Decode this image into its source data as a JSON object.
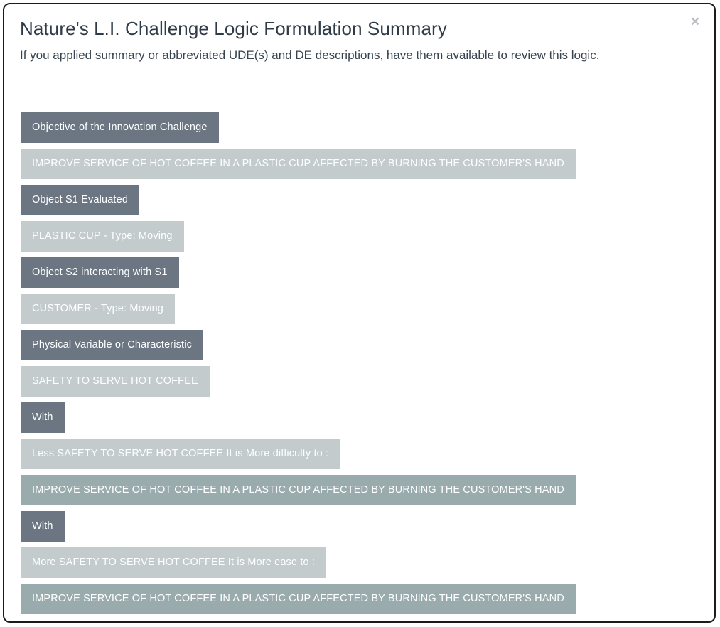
{
  "modal": {
    "title": "Nature's L.I. Challenge Logic Formulation Summary",
    "subtitle": "If you applied summary or abbreviated UDE(s) and DE descriptions, have them available to review this logic.",
    "close_label": "×",
    "close_icon": "close-icon",
    "colors": {
      "label_bar": "#6b7682",
      "value_bar": "#c3cbcd",
      "emphasis_bar": "#9aabad",
      "title_text": "#2f3b47",
      "bar_text": "#ffffff",
      "border": "#1b1b1b",
      "divider": "#e2e5e8"
    }
  },
  "logic_rows": [
    {
      "text": "Objective of the Innovation Challenge",
      "kind": "label"
    },
    {
      "text": "IMPROVE SERVICE OF HOT COFFEE IN A PLASTIC CUP AFFECTED BY BURNING THE CUSTOMER'S HAND",
      "kind": "value"
    },
    {
      "text": "Object S1 Evaluated",
      "kind": "label"
    },
    {
      "text": "PLASTIC CUP - Type: Moving",
      "kind": "value"
    },
    {
      "text": "Object S2 interacting with S1",
      "kind": "label"
    },
    {
      "text": "CUSTOMER - Type: Moving",
      "kind": "value"
    },
    {
      "text": "Physical Variable or Characteristic",
      "kind": "label"
    },
    {
      "text": "SAFETY TO SERVE HOT COFFEE",
      "kind": "value"
    },
    {
      "text": "With",
      "kind": "label"
    },
    {
      "text": "Less SAFETY TO SERVE HOT COFFEE It is More difficulty to :",
      "kind": "value"
    },
    {
      "text": "IMPROVE SERVICE OF HOT COFFEE IN A PLASTIC CUP AFFECTED BY BURNING THE CUSTOMER'S HAND",
      "kind": "emphasis"
    },
    {
      "text": "With",
      "kind": "label"
    },
    {
      "text": "More SAFETY TO SERVE HOT COFFEE It is More ease to :",
      "kind": "value"
    },
    {
      "text": "IMPROVE SERVICE OF HOT COFFEE IN A PLASTIC CUP AFFECTED BY BURNING THE CUSTOMER'S HAND",
      "kind": "emphasis"
    }
  ]
}
